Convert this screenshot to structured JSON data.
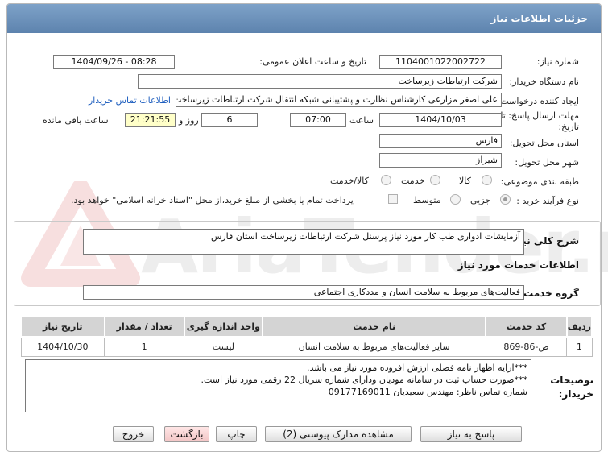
{
  "header": {
    "title": "جزئیات اطلاعات نیاز"
  },
  "watermark": {
    "text": "AriaTender.net"
  },
  "form": {
    "need_number_label": "شماره نیاز:",
    "need_number": "1104001022002722",
    "announce_label": "تاریخ و ساعت اعلان عمومی:",
    "announce_value": "1404/09/26 - 08:28",
    "buyer_org_label": "نام دستگاه خریدار:",
    "buyer_org": "شرکت ارتباطات زیرساخت",
    "requester_label": "ایجاد کننده درخواست:",
    "requester": "علی اصغر مزارعی کارشناس نظارت و پشتیبانی شبکه انتقال شرکت ارتباطات زیرساخت",
    "contact_link": "اطلاعات تماس خریدار",
    "deadline_label": "مهلت ارسال پاسخ: تا تاریخ:",
    "deadline_date": "1404/10/03",
    "time_label": "ساعت",
    "deadline_time": "07:00",
    "days_value": "6",
    "days_label": "روز و",
    "remaining_time": "21:21:55",
    "remaining_label": "ساعت باقی مانده",
    "province_label": "استان محل تحویل:",
    "province": "فارس",
    "city_label": "شهر محل تحویل:",
    "city": "شیراز",
    "category_label": "طبقه بندی موضوعی:",
    "category_options": [
      "کالا",
      "خدمت",
      "کالا/خدمت"
    ],
    "process_label": "نوع فرآیند خرید :",
    "process_options": [
      "جزیی",
      "متوسط"
    ],
    "payment_note": "پرداخت تمام یا بخشی از مبلغ خرید،از محل \"اسناد خزانه اسلامی\" خواهد بود."
  },
  "description": {
    "label": "شرح کلی نیاز:",
    "value": "آزمایشات ادواری طب کار مورد نیاز پرسنل شرکت ارتباطات زیرساخت استان فارس"
  },
  "services": {
    "title": "اطلاعات خدمات مورد نیاز",
    "group_label": "گروه خدمت:",
    "group_value": "فعالیت‌های مربوط به سلامت انسان و مددکاری اجتماعی",
    "columns": [
      "ردیف",
      "کد خدمت",
      "نام خدمت",
      "واحد اندازه گیری",
      "تعداد / مقدار",
      "تاریخ نیاز"
    ],
    "rows": [
      [
        "1",
        "ص-86-869",
        "سایر فعالیت‌های مربوط به سلامت انسان",
        "لیست",
        "1",
        "1404/10/30"
      ]
    ]
  },
  "notes": {
    "label": "توضیحات خریدار:",
    "lines": [
      "***ارایه اظهار نامه فصلی ارزش افزوده مورد نیاز می باشد.",
      "***صورت حساب ثبت در سامانه مودیان ودارای شماره سریال 22 رقمی مورد نیاز است.",
      "شماره تماس ناظر: مهندس سعیدیان 09177169011"
    ]
  },
  "buttons": {
    "reply": "پاسخ به نیاز",
    "attachments": "مشاهده مدارک پیوستی (2)",
    "print": "چاپ",
    "back": "بازگشت",
    "exit": "خروج"
  }
}
